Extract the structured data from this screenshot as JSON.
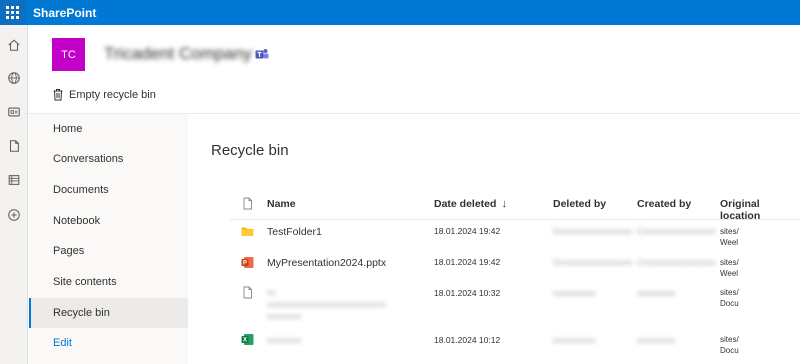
{
  "suite": {
    "app_name": "SharePoint"
  },
  "appbar": {
    "icons": [
      "home-icon",
      "globe-icon",
      "news-icon",
      "file-icon",
      "list-icon",
      "add-icon"
    ]
  },
  "site": {
    "logo_initials": "TC",
    "title": "Tricadent Company"
  },
  "command": {
    "empty_label": "Empty recycle bin"
  },
  "nav": {
    "items": [
      {
        "label": "Home"
      },
      {
        "label": "Conversations"
      },
      {
        "label": "Documents"
      },
      {
        "label": "Notebook"
      },
      {
        "label": "Pages"
      },
      {
        "label": "Site contents"
      },
      {
        "label": "Recycle bin"
      },
      {
        "label": "Edit"
      }
    ],
    "selected": "Recycle bin"
  },
  "main": {
    "title": "Recycle bin",
    "columns": {
      "name": "Name",
      "date_deleted": "Date deleted",
      "deleted_by": "Deleted by",
      "created_by": "Created by",
      "original_location": "Original location"
    },
    "rows": [
      {
        "type": "folder-icon",
        "name": "TestFolder1",
        "name2": "",
        "date": "18.01.2024 19:42",
        "deleted_by": "Gxxxxxxxxxxxxxxxxu",
        "created_by": "Cxxxxxxxxxxxxxxxxx",
        "loc1": "sites/",
        "loc2": "Weel"
      },
      {
        "type": "powerpoint-icon",
        "name": "MyPresentation2024.pptx",
        "name2": "",
        "date": "18.01.2024 19:42",
        "deleted_by": "Gxxxxxxxxxxxxxxxxu",
        "created_by": "Cxxxxxxxxxxxxxxxxx",
        "loc1": "sites/",
        "loc2": "Weel"
      },
      {
        "type": "file-icon",
        "name": "xx",
        "name2": "xxxxxxxxxxxxxxxxxxxxxxxxxxxx",
        "name3": "xxxxxxxx",
        "date": "18.01.2024 10:32",
        "deleted_by": "xxxxxxxxxx",
        "created_by": "xxxxxxxxx",
        "loc1": "sites/",
        "loc2": "Docu"
      },
      {
        "type": "excel-icon",
        "name": "xxxxxxxx",
        "name2": "",
        "date": "18.01.2024 10:12",
        "deleted_by": "xxxxxxxxxx",
        "created_by": "xxxxxxxxx",
        "loc1": "sites/",
        "loc2": "Docu"
      }
    ]
  },
  "colors": {
    "suite_bar": "#0078d4",
    "logo": "#c300c8",
    "accent": "#0078d4"
  }
}
